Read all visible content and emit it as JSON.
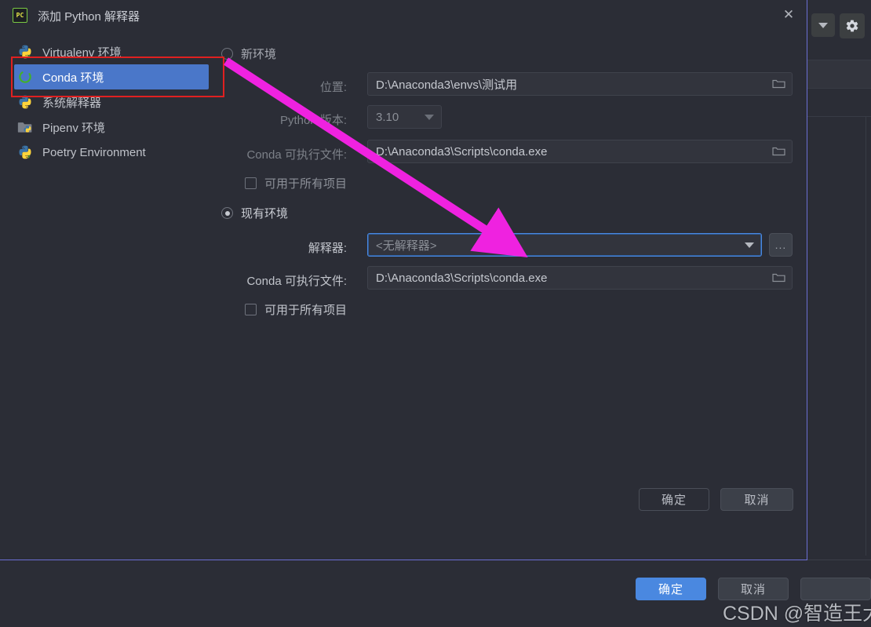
{
  "dialog": {
    "title": "添加 Python 解释器",
    "icon": "pycharm-icon",
    "icon_text": "PC",
    "close_label": "✕"
  },
  "sidebar": {
    "items": [
      {
        "label": "Virtualenv 环境",
        "icon": "python-virtualenv-icon",
        "selected": false
      },
      {
        "label": "Conda 环境",
        "icon": "conda-icon",
        "selected": true
      },
      {
        "label": "系统解释器",
        "icon": "python-system-icon",
        "selected": false
      },
      {
        "label": "Pipenv 环境",
        "icon": "pipenv-folder-icon",
        "selected": false
      },
      {
        "label": "Poetry Environment",
        "icon": "python-poetry-icon",
        "selected": false
      }
    ]
  },
  "form": {
    "new_env": {
      "radio_label": "新环境",
      "selected": false,
      "location_label": "位置:",
      "location_value": "D:\\Anaconda3\\envs\\测试用",
      "python_version_label": "Python 版本:",
      "python_version_value": "3.10",
      "conda_exe_label": "Conda 可执行文件:",
      "conda_exe_value": "D:\\Anaconda3\\Scripts\\conda.exe",
      "available_all_label": "可用于所有项目",
      "available_all_checked": false,
      "browse_icon": "folder-browse-icon"
    },
    "existing_env": {
      "radio_label": "现有环境",
      "selected": true,
      "interpreter_label": "解释器:",
      "interpreter_value": "<无解释器>",
      "interpreter_dropdown_icon": "chevron-down-icon",
      "more_button_label": "...",
      "conda_exe_label": "Conda 可执行文件:",
      "conda_exe_value": "D:\\Anaconda3\\Scripts\\conda.exe",
      "available_all_label": "可用于所有项目",
      "available_all_checked": false,
      "browse_icon": "folder-browse-icon"
    }
  },
  "dialog_buttons": {
    "ok": "确定",
    "cancel": "取消"
  },
  "background": {
    "toolbar_dropdown_icon": "chevron-down-icon",
    "toolbar_settings_icon": "gear-icon",
    "ok": "确定",
    "cancel": "取消"
  },
  "annotations": {
    "highlight_box": "red-rectangle-around-conda-item",
    "arrow": "magenta-arrow-to-interpreter-field"
  },
  "watermark": {
    "text": "CSDN @智造王大锤"
  },
  "colors": {
    "accent_blue": "#4a88e0",
    "selection_blue": "#4a77c9",
    "dialog_border": "#6b6fd4",
    "annotation_red": "#e02020",
    "annotation_magenta": "#ef22e0",
    "background": "#2b2d36",
    "field_bg": "#32343d",
    "conda_green": "#43b02a"
  }
}
